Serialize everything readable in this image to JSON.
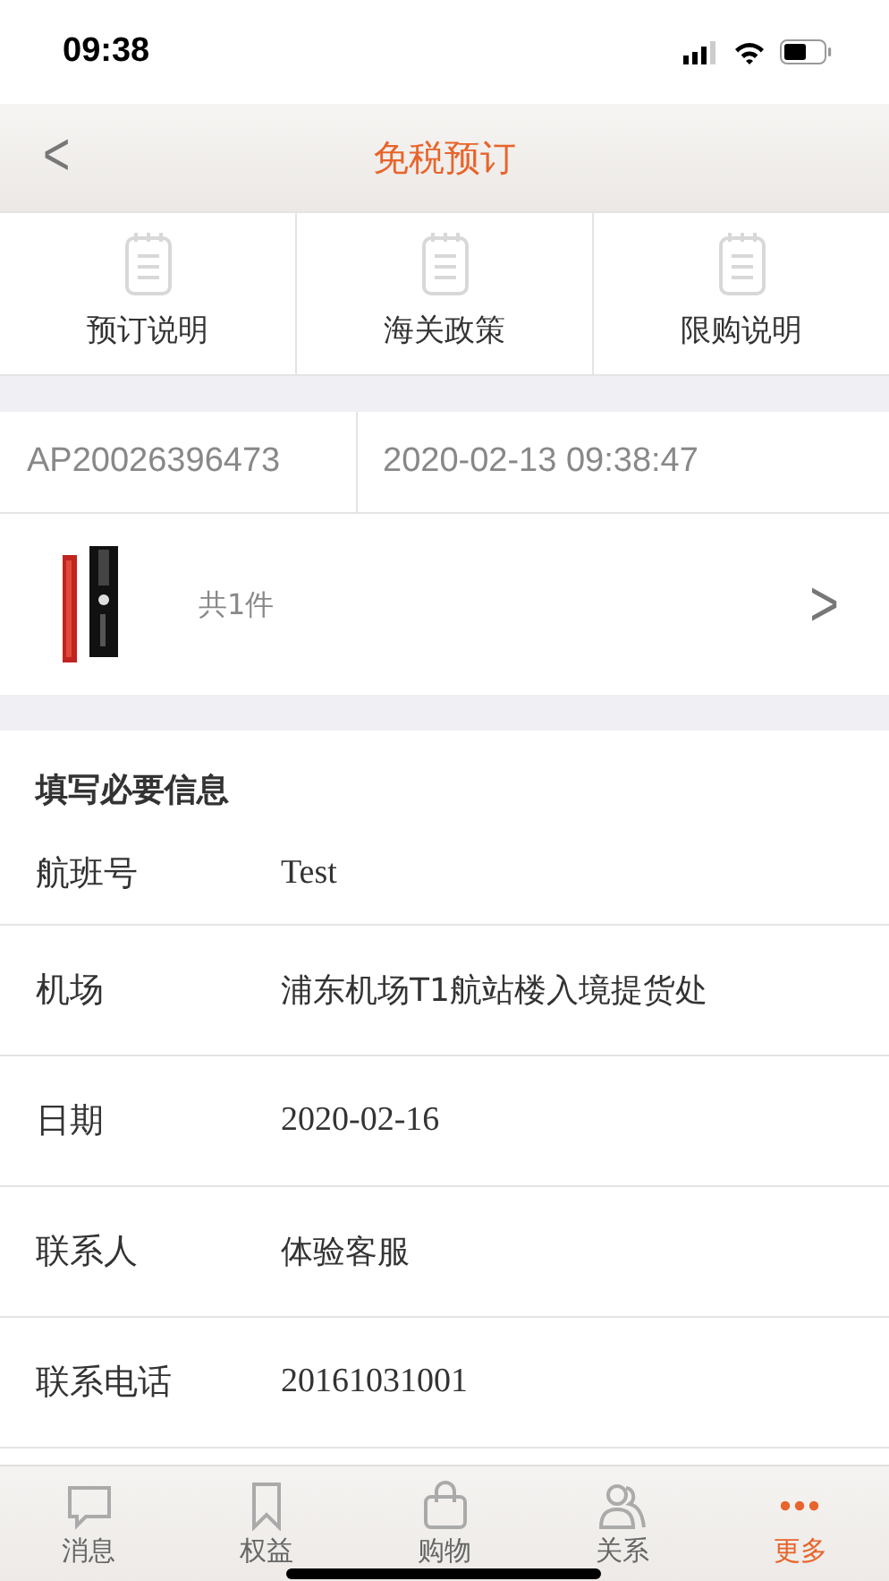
{
  "status_bar": {
    "time": "09:38"
  },
  "nav": {
    "back": "<",
    "title": "免税预订"
  },
  "doc_links": [
    {
      "label": "预订说明"
    },
    {
      "label": "海关政策"
    },
    {
      "label": "限购说明"
    }
  ],
  "order": {
    "number": "AP20026396473",
    "time": "2020-02-13 09:38:47"
  },
  "product": {
    "count": "共1件",
    "chevron": ">"
  },
  "form": {
    "title": "填写必要信息",
    "fields": [
      {
        "label": "航班号",
        "value": "Test"
      },
      {
        "label": "机场",
        "value": "浦东机场T1航站楼入境提货处"
      },
      {
        "label": "日期",
        "value": "2020-02-16"
      },
      {
        "label": "联系人",
        "value": "体验客服"
      },
      {
        "label": "联系电话",
        "value": "20161031001"
      }
    ]
  },
  "tab_bar": [
    {
      "label": "消息",
      "kind": "chat",
      "selected": false
    },
    {
      "label": "权益",
      "kind": "bookmark",
      "selected": false
    },
    {
      "label": "购物",
      "kind": "bag",
      "selected": false
    },
    {
      "label": "关系",
      "kind": "people",
      "selected": false
    },
    {
      "label": "更多",
      "kind": "more",
      "selected": true
    }
  ]
}
